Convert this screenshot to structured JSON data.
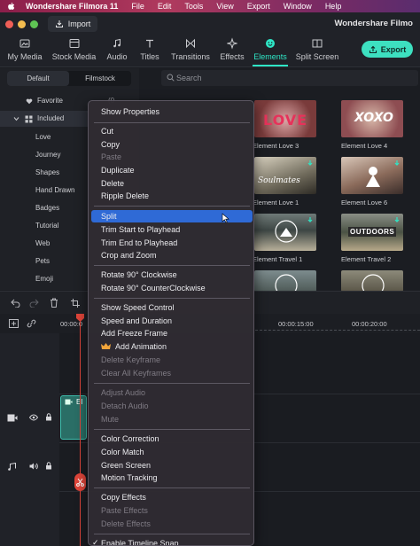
{
  "mac_menu": {
    "app": "Wondershare Filmora 11",
    "items": [
      "File",
      "Edit",
      "Tools",
      "View",
      "Export",
      "Window",
      "Help"
    ]
  },
  "titlebar": {
    "import_label": "Import",
    "app_title": "Wondershare Filmo"
  },
  "toolbar": {
    "tabs": [
      {
        "label": "My Media",
        "icon": "media-icon"
      },
      {
        "label": "Stock Media",
        "icon": "stock-icon"
      },
      {
        "label": "Audio",
        "icon": "music-note-icon"
      },
      {
        "label": "Titles",
        "icon": "titles-icon"
      },
      {
        "label": "Transitions",
        "icon": "transitions-icon"
      },
      {
        "label": "Effects",
        "icon": "sparkle-icon"
      },
      {
        "label": "Elements",
        "icon": "elements-icon"
      },
      {
        "label": "Split Screen",
        "icon": "split-screen-icon"
      }
    ],
    "active_tab": "Elements",
    "export_label": "Export"
  },
  "left_panel": {
    "segments": [
      "Default",
      "Filmstock"
    ],
    "favorite": "Favorite",
    "favorite_count": "(0",
    "included": "Included",
    "categories": [
      "Love",
      "Journey",
      "Shapes",
      "Hand Drawn",
      "Badges",
      "Tutorial",
      "Web",
      "Pets",
      "Emoji"
    ]
  },
  "search": {
    "placeholder": "Search"
  },
  "media_items": [
    {
      "label": "Element Love 3",
      "overlay": "LOVE"
    },
    {
      "label": "Element Love 4",
      "overlay": "XOXO"
    },
    {
      "label": "Element Love 1",
      "overlay": "Soulmates"
    },
    {
      "label": "Element Love 6",
      "overlay": ""
    },
    {
      "label": "Element Travel 1",
      "overlay": ""
    },
    {
      "label": "Element Travel 2",
      "overlay": "OUTDOORS"
    },
    {
      "label": "",
      "overlay": ""
    },
    {
      "label": "",
      "overlay": ""
    }
  ],
  "timeline": {
    "ticks": [
      "00:00:0",
      "00:00:15:00",
      "00:00:20:00"
    ],
    "clip_label": "El"
  },
  "context_menu": {
    "items": [
      {
        "label": "Show Properties",
        "enabled": true
      },
      {
        "label": "Cut",
        "enabled": true
      },
      {
        "label": "Copy",
        "enabled": true
      },
      {
        "label": "Paste",
        "enabled": false
      },
      {
        "label": "Duplicate",
        "enabled": true
      },
      {
        "label": "Delete",
        "enabled": true
      },
      {
        "label": "Ripple Delete",
        "enabled": true
      },
      {
        "label": "Split",
        "enabled": true,
        "highlighted": true
      },
      {
        "label": "Trim Start to Playhead",
        "enabled": true
      },
      {
        "label": "Trim End to Playhead",
        "enabled": true
      },
      {
        "label": "Crop and Zoom",
        "enabled": true
      },
      {
        "label": "Rotate 90° Clockwise",
        "enabled": true
      },
      {
        "label": "Rotate 90° CounterClockwise",
        "enabled": true
      },
      {
        "label": "Show Speed Control",
        "enabled": true
      },
      {
        "label": "Speed and Duration",
        "enabled": true
      },
      {
        "label": "Add Freeze Frame",
        "enabled": true
      },
      {
        "label": "Add Animation",
        "enabled": true,
        "icon": "crown-icon"
      },
      {
        "label": "Delete Keyframe",
        "enabled": false
      },
      {
        "label": "Clear All Keyframes",
        "enabled": false
      },
      {
        "label": "Adjust Audio",
        "enabled": false
      },
      {
        "label": "Detach Audio",
        "enabled": false
      },
      {
        "label": "Mute",
        "enabled": false
      },
      {
        "label": "Color Correction",
        "enabled": true
      },
      {
        "label": "Color Match",
        "enabled": true
      },
      {
        "label": "Green Screen",
        "enabled": true
      },
      {
        "label": "Motion Tracking",
        "enabled": true
      },
      {
        "label": "Copy Effects",
        "enabled": true
      },
      {
        "label": "Paste Effects",
        "enabled": false
      },
      {
        "label": "Delete Effects",
        "enabled": false
      },
      {
        "label": "Enable Timeline Snap",
        "enabled": true,
        "checked": true
      }
    ]
  },
  "colors": {
    "accent": "#2ee6c6",
    "highlight": "#2f6ad6",
    "playhead": "#e0453a"
  }
}
